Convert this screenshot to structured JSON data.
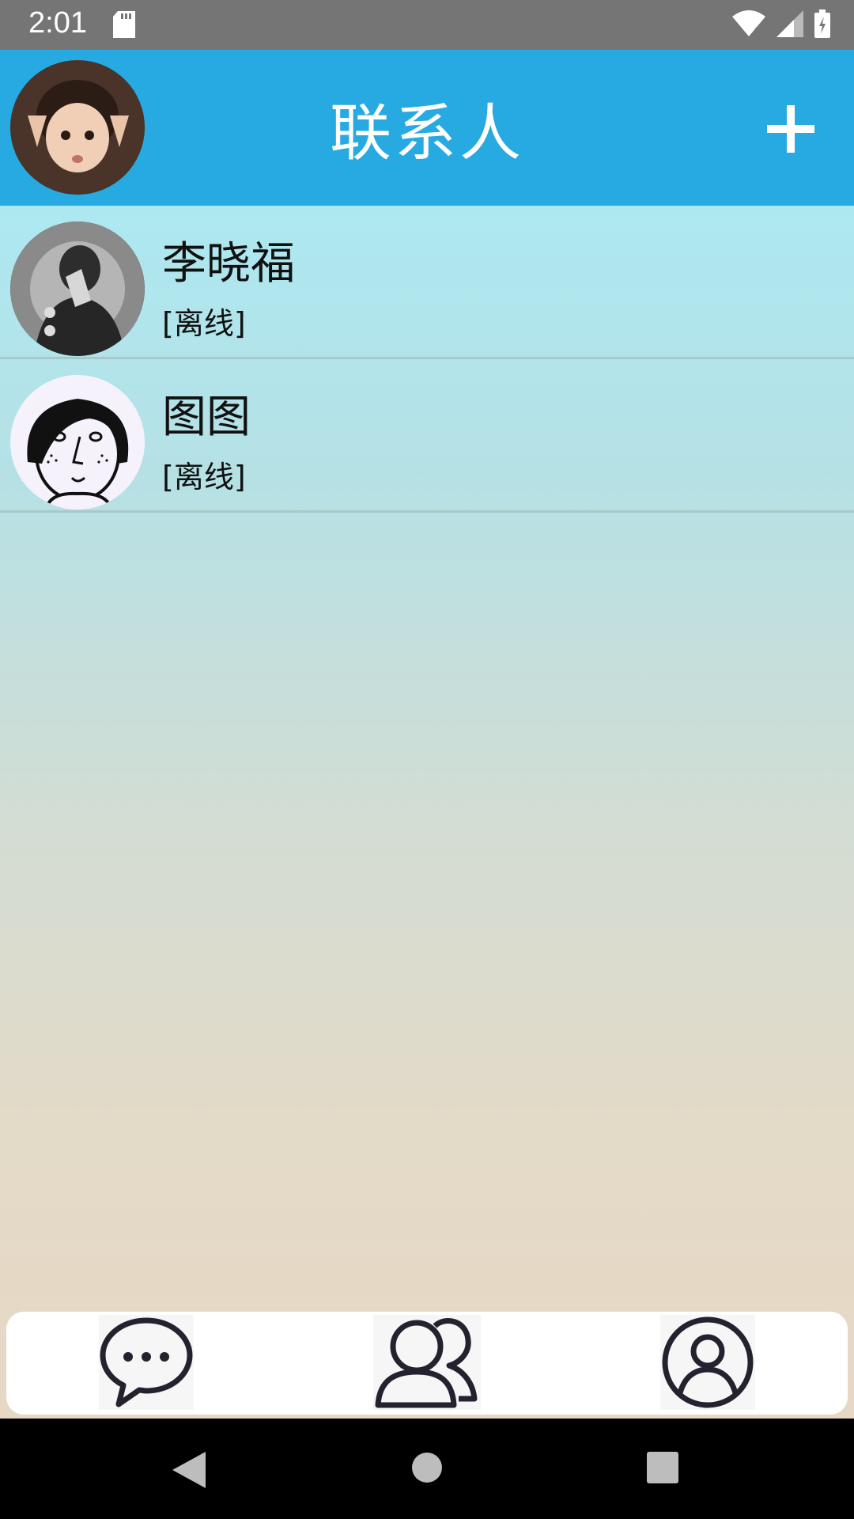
{
  "status_bar": {
    "time": "2:01",
    "icons": [
      "sd-card-icon",
      "wifi-icon",
      "signal-icon",
      "battery-icon"
    ]
  },
  "header": {
    "title": "联系人",
    "add_icon": "plus-icon",
    "background": "#27aae1"
  },
  "contacts": [
    {
      "name": "李晓福",
      "status": "[离线]"
    },
    {
      "name": "图图",
      "status": "[离线]"
    }
  ],
  "bottom_nav": {
    "items": [
      "chat-bubble-icon",
      "contacts-icon",
      "profile-icon"
    ]
  },
  "system_nav": [
    "back-icon",
    "home-icon",
    "recents-icon"
  ]
}
